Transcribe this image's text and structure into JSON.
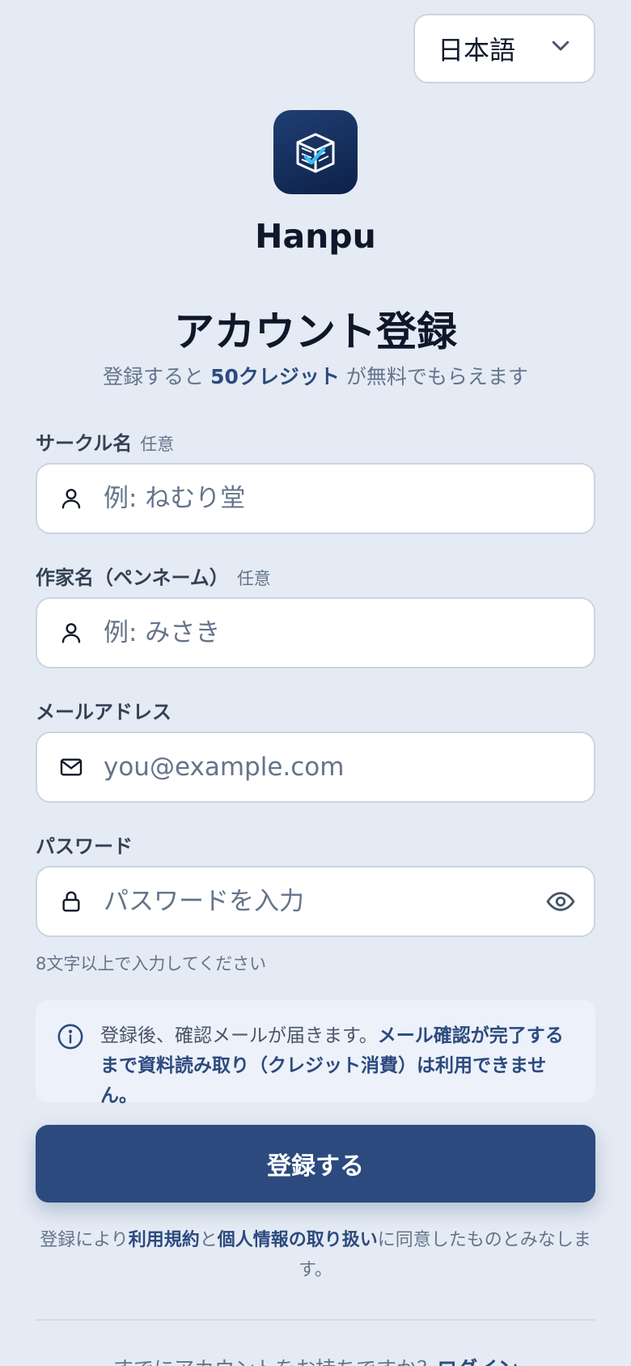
{
  "language": {
    "selected": "日本語"
  },
  "brand": {
    "name": "Hanpu"
  },
  "header": {
    "title": "アカウント登録",
    "subtitle_prefix": "登録すると ",
    "subtitle_highlight": "50クレジット",
    "subtitle_suffix": " が無料でもらえます"
  },
  "form": {
    "circle_name": {
      "label": "サークル名",
      "optional": "任意",
      "placeholder": "例: ねむり堂",
      "value": ""
    },
    "author_name": {
      "label": "作家名（ペンネーム）",
      "optional": "任意",
      "placeholder": "例: みさき",
      "value": ""
    },
    "email": {
      "label": "メールアドレス",
      "placeholder": "you@example.com",
      "value": ""
    },
    "password": {
      "label": "パスワード",
      "placeholder": "パスワードを入力",
      "value": "",
      "hint": "8文字以上で入力してください"
    }
  },
  "notice": {
    "text": "登録後、確認メールが届きます。",
    "bold": "メール確認が完了するまで資料読み取り（クレジット消費）は利用できません。"
  },
  "submit": {
    "label": "登録する"
  },
  "terms": {
    "prefix": "登録により",
    "link1": "利用規約",
    "middle": "と",
    "link2": "個人情報の取り扱い",
    "suffix": "に同意したものとみなします。"
  },
  "login": {
    "prompt": "すでにアカウントをお持ちですか？",
    "link": "ログイン"
  },
  "colors": {
    "primary": "#2c4a7e",
    "background": "#e5ebf4",
    "notice_bg": "#edf1fa"
  }
}
